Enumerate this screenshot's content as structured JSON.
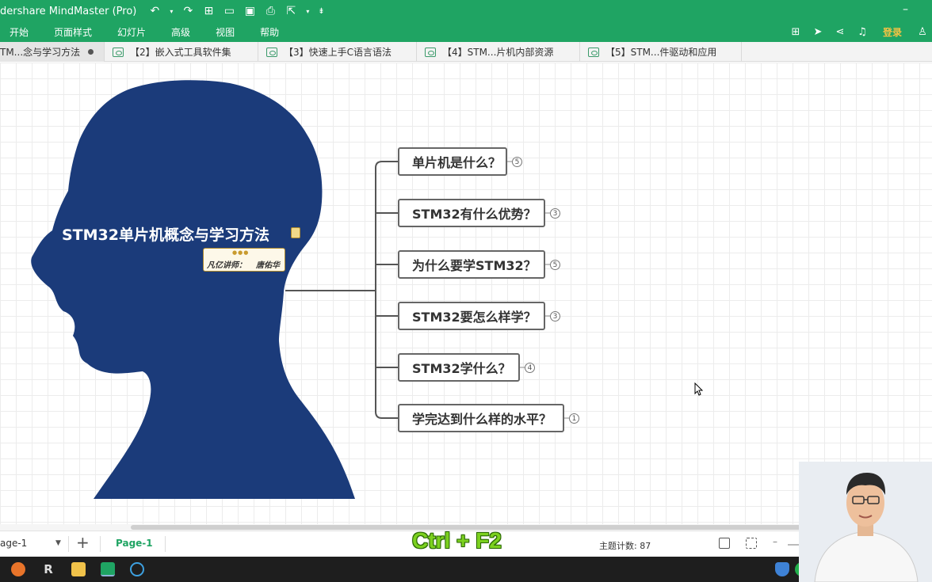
{
  "window": {
    "title": "dershare MindMaster (Pro)",
    "quick_access": [
      "undo-icon",
      "redo-icon",
      "new-icon",
      "open-icon",
      "save-icon",
      "print-icon",
      "export-icon",
      "customize-icon"
    ]
  },
  "menu": {
    "items": [
      "开始",
      "页面样式",
      "幻灯片",
      "高级",
      "视图",
      "帮助"
    ],
    "login": "登录",
    "right_icons": [
      "fullscreen-icon",
      "send-icon",
      "share-icon",
      "bell-icon",
      "shirt-icon"
    ]
  },
  "tabs": [
    {
      "label": "TM...念与学习方法",
      "active": true
    },
    {
      "label": "【2】嵌入式工具软件集",
      "active": false
    },
    {
      "label": "【3】快速上手C语言语法",
      "active": false
    },
    {
      "label": "【4】STM...片机内部资源",
      "active": false
    },
    {
      "label": "【5】STM...件驱动和应用",
      "active": false
    }
  ],
  "mindmap": {
    "central": "STM32单片机概念与学习方法",
    "badge": {
      "dots": "●●●",
      "left": "凡亿讲师：",
      "right": "唐佑华"
    },
    "branches": [
      {
        "label": "单片机是什么？",
        "count": "5"
      },
      {
        "label": "STM32有什么优势？",
        "count": "3"
      },
      {
        "label": "为什么要学STM32？",
        "count": "5"
      },
      {
        "label": "STM32要怎么样学？",
        "count": "3"
      },
      {
        "label": "STM32学什么？",
        "count": "4"
      },
      {
        "label": "学完达到什么样的水平？",
        "count": "1"
      }
    ],
    "colors": {
      "head": "#1b3b7a",
      "accent": "#1fa463"
    }
  },
  "status": {
    "page_select": "age-1",
    "page_tab": "Page-1",
    "shortcut_overlay": "Ctrl + F2",
    "topic_count": "主题计数:  87"
  }
}
